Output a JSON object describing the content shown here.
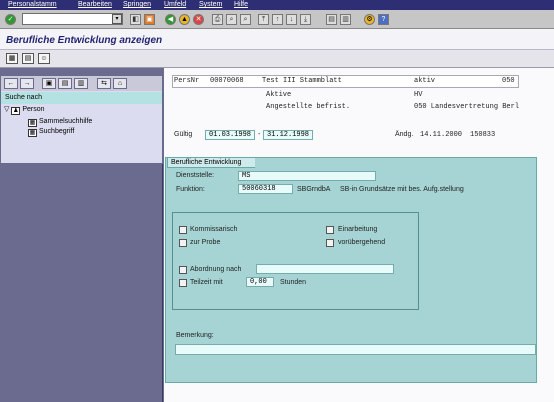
{
  "menubar": {
    "items": [
      "Personalstamm",
      "Bearbeiten",
      "Springen",
      "Umfeld",
      "System",
      "Hilfe"
    ]
  },
  "toolbar": {
    "command_value": "",
    "enter_icon": "check-icon",
    "save_icon": "save-icon",
    "back_icon": "back-icon",
    "exit_icon": "exit-icon",
    "cancel_icon": "cancel-icon"
  },
  "page": {
    "title": "Berufliche Entwicklung anzeigen"
  },
  "nav": {
    "suche_nach": "Suche nach",
    "tree": [
      {
        "label": "Person"
      },
      {
        "label": "Sammelsuchhilfe"
      },
      {
        "label": "Suchbegriff"
      }
    ]
  },
  "header": {
    "persnr_label": "PersNr",
    "persnr_value": "00070068",
    "name": "Test III Stammblatt",
    "status": "aktiv",
    "code": "050",
    "aktive": "Aktive",
    "hv": "HV",
    "angestellte": "Angestellte befrist.",
    "org": "050 Landesvertretung Berl",
    "gueltig_label": "Gültig",
    "gueltig_from": "01.03.1998",
    "gueltig_to": "31.12.1998",
    "aendg_label": "Ändg.",
    "aendg_date": "14.11.2000",
    "aendg_num": "150833"
  },
  "section": {
    "tab_label": "Berufliche Entwicklung",
    "dienststelle_label": "Dienststelle:",
    "dienststelle_value": "MS",
    "funktion_label": "Funktion:",
    "funktion_value": "50060318",
    "funktion_code": "SBGrndbA",
    "funktion_text": "SB-in Grundsätze mit bes. Aufg.stellung",
    "kommissarisch": "Kommissarisch",
    "zur_probe": "zur Probe",
    "einarbeitung": "Einarbeitung",
    "voruebergehend": "vorübergehend",
    "abordnung": "Abordnung nach",
    "abordnung_value": "",
    "teilzeit": "Teilzeit mit",
    "teilzeit_value": "0,00",
    "stunden": "Stunden",
    "bemerkung_label": "Bemerkung:",
    "bemerkung_value": ""
  },
  "colors": {
    "menubar": "#2e2e75",
    "title_text": "#232370",
    "section_bg": "#a6d4d4",
    "field_bg": "#e7fbfb",
    "sidebar_bg": "#6b6b8f"
  }
}
